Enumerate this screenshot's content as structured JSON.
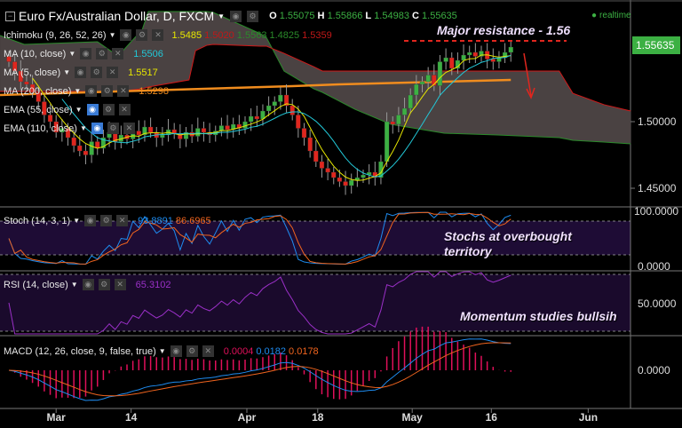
{
  "header": {
    "symbol": "Euro Fx/Australian Dollar, D, FXCM",
    "o_label": "O",
    "o": "1.55075",
    "h_label": "H",
    "h": "1.55866",
    "l_label": "L",
    "l": "1.54983",
    "c_label": "C",
    "c": "1.55635",
    "realtime": "realtime"
  },
  "indicators": {
    "ichimoku": {
      "label": "Ichimoku (9, 26, 52, 26)",
      "values": [
        "1.5485",
        "1.5020",
        "1.5563",
        "1.4825",
        "1.5359"
      ]
    },
    "ma10": {
      "label": "MA (10, close)",
      "value": "1.5506"
    },
    "ma5": {
      "label": "MA (5, close)",
      "value": "1.5517"
    },
    "ma200": {
      "label": "MA (200, close)",
      "value": "1.5298"
    },
    "ema55": {
      "label": "EMA (55, close)"
    },
    "ema110": {
      "label": "EMA (110, close)"
    },
    "stoch": {
      "label": "Stoch (14, 3, 1)",
      "k": "93.8891",
      "d": "86.6965"
    },
    "rsi": {
      "label": "RSI (14, close)",
      "value": "65.3102"
    },
    "macd": {
      "label": "MACD (12, 26, close, 9, false, true)",
      "hist": "0.0004",
      "macd": "0.0182",
      "signal": "0.0178"
    }
  },
  "annotations": {
    "resistance": "Major resistance - 1.56",
    "stoch": "Stochs at overbought territory",
    "momentum": "Momentum studies bullsih"
  },
  "price_axis": {
    "current": "1.55635",
    "ticks": [
      "1.50000",
      "1.45000"
    ],
    "stoch_ticks": [
      "100.0000",
      "0.0000"
    ],
    "rsi_ticks": [
      "50.0000"
    ],
    "macd_ticks": [
      "0.0000"
    ]
  },
  "chart_data": {
    "type": "candlestick",
    "x_tick_labels": [
      {
        "label": "Mar",
        "day": 8
      },
      {
        "label": "14",
        "day": 20.7
      },
      {
        "label": "Apr",
        "day": 40.3
      },
      {
        "label": "18",
        "day": 52.3
      },
      {
        "label": "May",
        "day": 68.3
      },
      {
        "label": "16",
        "day": 81.7
      },
      {
        "label": "Jun",
        "day": 98.1
      }
    ],
    "closes": [
      1.545,
      1.538,
      1.53,
      1.528,
      1.522,
      1.515,
      1.505,
      1.5,
      1.492,
      1.495,
      1.488,
      1.482,
      1.478,
      1.475,
      1.485,
      1.48,
      1.488,
      1.492,
      1.485,
      1.49,
      1.487,
      1.493,
      1.49,
      1.496,
      1.492,
      1.488,
      1.49,
      1.494,
      1.491,
      1.487,
      1.492,
      1.489,
      1.495,
      1.492,
      1.49,
      1.493,
      1.497,
      1.494,
      1.498,
      1.495,
      1.5,
      1.504,
      1.502,
      1.508,
      1.512,
      1.515,
      1.52,
      1.512,
      1.505,
      1.495,
      1.488,
      1.478,
      1.47,
      1.465,
      1.462,
      1.458,
      1.455,
      1.452,
      1.456,
      1.458,
      1.46,
      1.462,
      1.458,
      1.47,
      1.5,
      1.498,
      1.505,
      1.51,
      1.52,
      1.528,
      1.53,
      1.535,
      1.527,
      1.545,
      1.548,
      1.54,
      1.546,
      1.55,
      1.552,
      1.549,
      1.553,
      1.547,
      1.545,
      1.548,
      1.552,
      1.556
    ],
    "ichimoku_cloud": {
      "day": [
        -1.5,
        2.6,
        15,
        18.5,
        22.6,
        23.6,
        30.5,
        31.6,
        33.5,
        34.6,
        42.6,
        43.6,
        46.6,
        51.6,
        53.1,
        58.6,
        64.7,
        73.7,
        82.7,
        93.2,
        95.5,
        100.8,
        105.3
      ],
      "span_a": [
        1.5647,
        1.558,
        1.56,
        1.5493,
        1.5693,
        1.5827,
        1.5827,
        1.5827,
        1.5827,
        1.582,
        1.566,
        1.5633,
        1.538,
        1.5247,
        1.522,
        1.5093,
        1.498,
        1.4913,
        1.49,
        1.488,
        1.486,
        1.4847,
        1.4833
      ],
      "span_b": [
        1.5227,
        1.5227,
        1.5227,
        1.5227,
        1.5247,
        1.526,
        1.5313,
        1.5533,
        1.5573,
        1.558,
        1.5567,
        1.5567,
        1.5513,
        1.5413,
        1.538,
        1.538,
        1.538,
        1.538,
        1.538,
        1.538,
        1.5213,
        1.5127,
        1.508
      ]
    },
    "ma200": {
      "day": [
        -1.5,
        48,
        56,
        85
      ],
      "values": [
        1.52,
        1.5267,
        1.528,
        1.5313
      ]
    },
    "resistance_level": 1.56,
    "ylim": [
      1.43,
      1.595
    ],
    "colors": {
      "up": "#3cb043",
      "down": "#e0261e",
      "ma5": "#e6e600",
      "ma10": "#22c8d8",
      "ma200": "#f08c1e",
      "stoch_k": "#1e8cf0",
      "stoch_d": "#f0641e",
      "rsi": "#9b30c8",
      "macd": "#1e8cf0",
      "signal": "#f0641e",
      "hist": "#e0105a"
    }
  }
}
